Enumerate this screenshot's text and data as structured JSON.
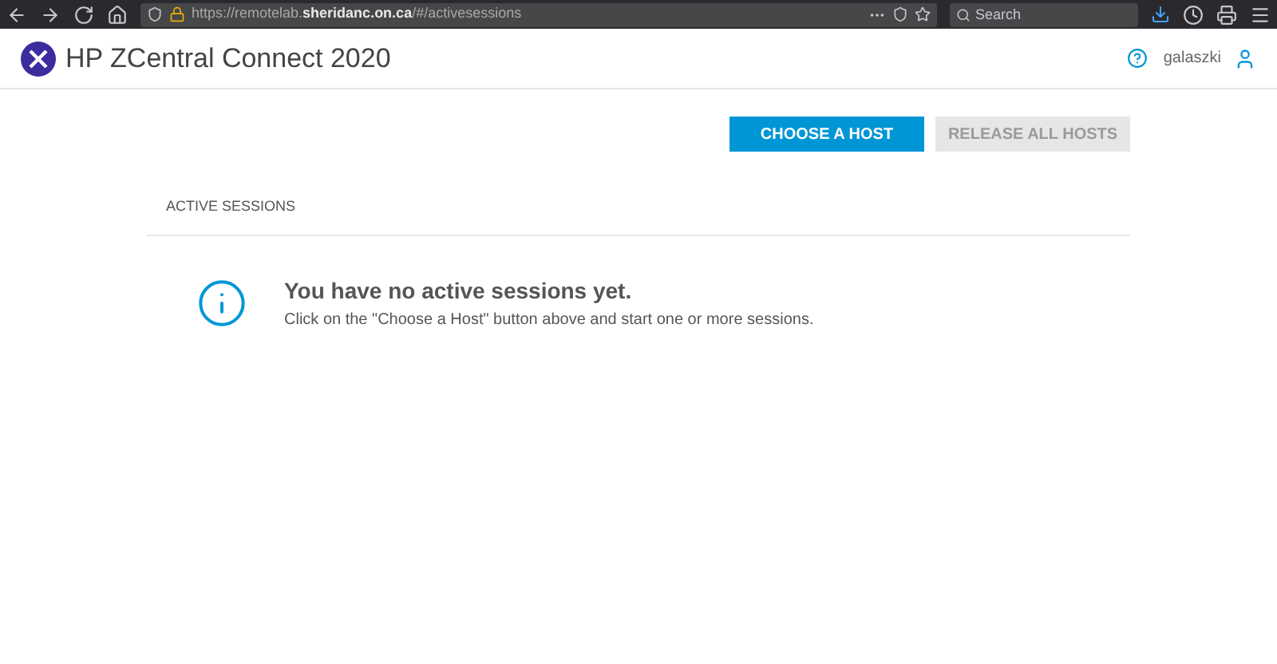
{
  "browser": {
    "url": "https://remotelab.**sheridanc.on.ca**/#/activesessions",
    "search": {
      "placeholder": "Search"
    }
  },
  "header": {
    "title": "HP ZCentral Connect 2020",
    "user": "galaszki"
  },
  "actions": [
    {
      "label": "CHOOSE A HOST",
      "disabled": false
    },
    {
      "label": "RELEASE ALL HOSTS",
      "disabled": true
    }
  ],
  "section": {
    "title": "ACTIVE SESSIONS"
  },
  "empty_state": {
    "title": "You have no active sessions yet.",
    "message": "Click on the \"Choose a Host\" button above and start one or more sessions."
  }
}
